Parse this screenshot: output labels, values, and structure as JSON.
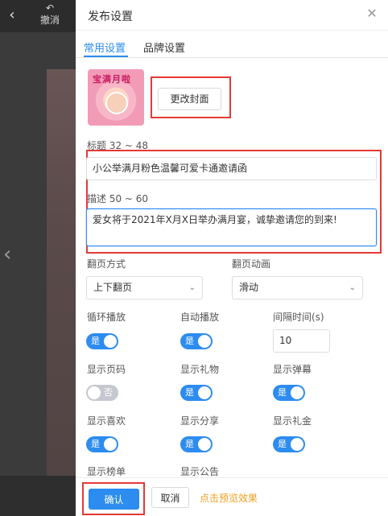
{
  "toolbar": {
    "back_icon": "chevron-left-icon",
    "undo_icon": "undo-icon",
    "undo_label": "撤消"
  },
  "dialog": {
    "title": "发布设置",
    "close_icon": "close-icon",
    "tabs": [
      {
        "label": "常用设置",
        "active": true
      },
      {
        "label": "品牌设置",
        "active": false
      }
    ],
    "cover": {
      "text": "宝满月啦",
      "change_label": "更改封面"
    },
    "title_field": {
      "label": "标题 32 ~ 48",
      "value": "小公举满月粉色温馨可爱卡通邀请函"
    },
    "desc_field": {
      "label": "描述 50 ~ 60",
      "value": "爱女将于2021年X月X日举办满月宴，诚挚邀请您的到来!"
    },
    "page_turn": {
      "label": "翻页方式",
      "value": "上下翻页"
    },
    "page_anim": {
      "label": "翻页动画",
      "value": "滑动"
    },
    "loop_play": {
      "label": "循环播放",
      "state": "是",
      "on": true
    },
    "auto_play": {
      "label": "自动播放",
      "state": "是",
      "on": true
    },
    "interval": {
      "label": "间隔时间(s)",
      "value": "10"
    },
    "show_page_no": {
      "label": "显示页码",
      "state": "否",
      "on": false
    },
    "show_gift": {
      "label": "显示礼物",
      "state": "是",
      "on": true
    },
    "show_barrage": {
      "label": "显示弹幕",
      "state": "是",
      "on": true
    },
    "show_like": {
      "label": "显示喜欢",
      "state": "是",
      "on": true
    },
    "show_share": {
      "label": "显示分享",
      "state": "是",
      "on": true
    },
    "show_money": {
      "label": "显示礼金",
      "state": "是",
      "on": true
    },
    "show_ranking": {
      "label": "显示榜单"
    },
    "show_notice": {
      "label": "显示公告"
    },
    "footer": {
      "confirm_label": "确认",
      "cancel_label": "取消",
      "preview_label": "点击预览效果"
    }
  },
  "colors": {
    "accent": "#2d8cf0",
    "highlight_box": "#e53935",
    "preview_link": "#f0a020"
  }
}
